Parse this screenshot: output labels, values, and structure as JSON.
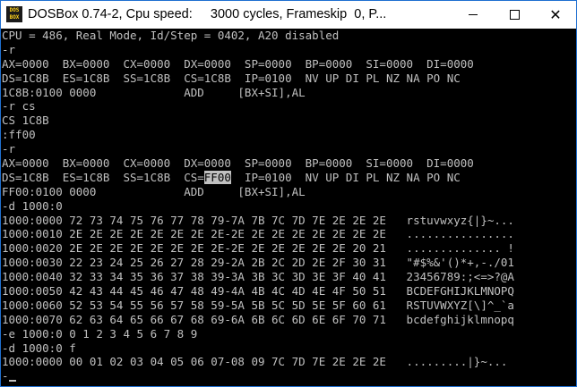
{
  "window": {
    "title": "DOSBox 0.74-2, Cpu speed:     3000 cycles, Frameskip  0, P...",
    "icon_label_top": "DOS",
    "icon_label_bottom": "BOX",
    "buttons": {
      "minimize": "minimize-icon",
      "maximize": "maximize-icon",
      "close": "✕"
    }
  },
  "terminal": {
    "lines": [
      "CPU = 486, Real Mode, Id/Step = 0402, A20 disabled",
      "-r",
      "AX=0000  BX=0000  CX=0000  DX=0000  SP=0000  BP=0000  SI=0000  DI=0000",
      "DS=1C8B  ES=1C8B  SS=1C8B  CS=1C8B  IP=0100  NV UP DI PL NZ NA PO NC",
      "1C8B:0100 0000             ADD     [BX+SI],AL",
      "-r cs",
      "CS 1C8B",
      ":ff00",
      "-r",
      "AX=0000  BX=0000  CX=0000  DX=0000  SP=0000  BP=0000  SI=0000  DI=0000"
    ],
    "cs_line": {
      "before": "DS=1C8B  ES=1C8B  SS=1C8B  CS=",
      "highlight": "FF00",
      "after": "  IP=0100  NV UP DI PL NZ NA PO NC"
    },
    "lines_after": [
      "FF00:0100 0000             ADD     [BX+SI],AL",
      "-d 1000:0",
      "1000:0000 72 73 74 75 76 77 78 79-7A 7B 7C 7D 7E 2E 2E 2E   rstuvwxyz{|}~...",
      "1000:0010 2E 2E 2E 2E 2E 2E 2E 2E-2E 2E 2E 2E 2E 2E 2E 2E   ................",
      "1000:0020 2E 2E 2E 2E 2E 2E 2E 2E-2E 2E 2E 2E 2E 2E 20 21   .............. !",
      "1000:0030 22 23 24 25 26 27 28 29-2A 2B 2C 2D 2E 2F 30 31   \"#$%&'()*+,-./01",
      "1000:0040 32 33 34 35 36 37 38 39-3A 3B 3C 3D 3E 3F 40 41   23456789:;<=>?@A",
      "1000:0050 42 43 44 45 46 47 48 49-4A 4B 4C 4D 4E 4F 50 51   BCDEFGHIJKLMNOPQ",
      "1000:0060 52 53 54 55 56 57 58 59-5A 5B 5C 5D 5E 5F 60 61   RSTUVWXYZ[\\]^_`a",
      "1000:0070 62 63 64 65 66 67 68 69-6A 6B 6C 6D 6E 6F 70 71   bcdefghijklmnopq",
      "-e 1000:0 0 1 2 3 4 5 6 7 8 9",
      "-d 1000:0 f",
      "1000:0000 00 01 02 03 04 05 06 07-08 09 7C 7D 7E 2E 2E 2E   .........|}~..."
    ],
    "prompt": "-"
  },
  "colors": {
    "fg": "#c0c0c0",
    "bg": "#000000",
    "titlebar": "#ffffff"
  }
}
